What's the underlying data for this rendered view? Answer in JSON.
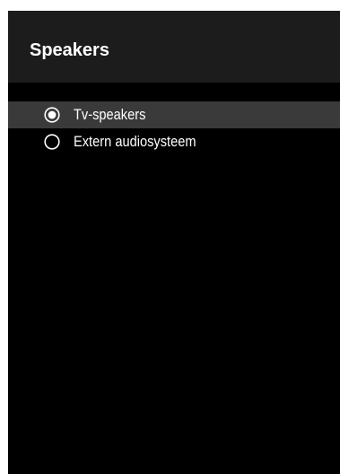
{
  "dialog": {
    "title": "Speakers"
  },
  "options": [
    {
      "label": "Tv-speakers",
      "selected": true,
      "icon": "radio-selected-icon"
    },
    {
      "label": "Extern audiosysteem",
      "selected": false,
      "icon": "radio-unselected-icon"
    }
  ],
  "colors": {
    "background": "#000000",
    "header": "#1c1c1c",
    "highlight": "#3a3a3a",
    "text": "#ffffff",
    "border": "#ffffff"
  }
}
